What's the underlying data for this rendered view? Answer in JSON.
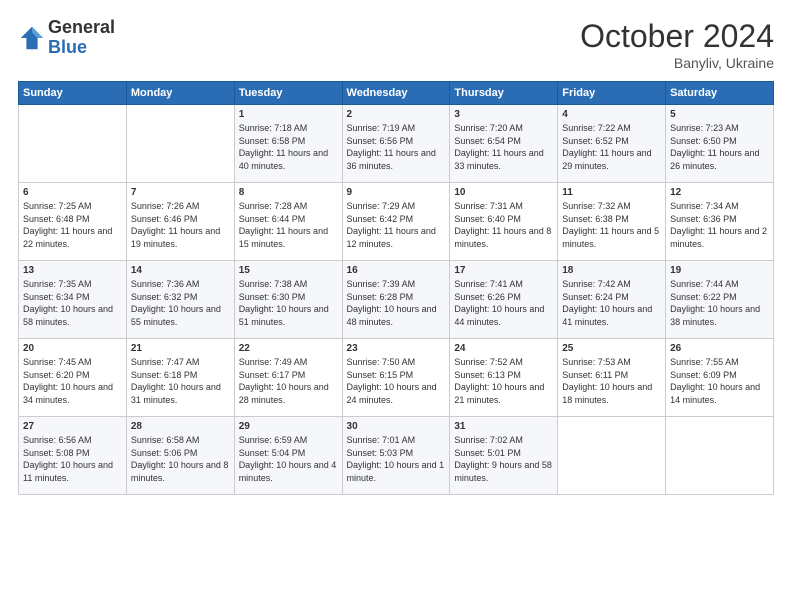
{
  "header": {
    "logo_general": "General",
    "logo_blue": "Blue",
    "month": "October 2024",
    "location": "Banyliv, Ukraine"
  },
  "weekdays": [
    "Sunday",
    "Monday",
    "Tuesday",
    "Wednesday",
    "Thursday",
    "Friday",
    "Saturday"
  ],
  "weeks": [
    [
      {
        "day": "",
        "sunrise": "",
        "sunset": "",
        "daylight": ""
      },
      {
        "day": "",
        "sunrise": "",
        "sunset": "",
        "daylight": ""
      },
      {
        "day": "1",
        "sunrise": "Sunrise: 7:18 AM",
        "sunset": "Sunset: 6:58 PM",
        "daylight": "Daylight: 11 hours and 40 minutes."
      },
      {
        "day": "2",
        "sunrise": "Sunrise: 7:19 AM",
        "sunset": "Sunset: 6:56 PM",
        "daylight": "Daylight: 11 hours and 36 minutes."
      },
      {
        "day": "3",
        "sunrise": "Sunrise: 7:20 AM",
        "sunset": "Sunset: 6:54 PM",
        "daylight": "Daylight: 11 hours and 33 minutes."
      },
      {
        "day": "4",
        "sunrise": "Sunrise: 7:22 AM",
        "sunset": "Sunset: 6:52 PM",
        "daylight": "Daylight: 11 hours and 29 minutes."
      },
      {
        "day": "5",
        "sunrise": "Sunrise: 7:23 AM",
        "sunset": "Sunset: 6:50 PM",
        "daylight": "Daylight: 11 hours and 26 minutes."
      }
    ],
    [
      {
        "day": "6",
        "sunrise": "Sunrise: 7:25 AM",
        "sunset": "Sunset: 6:48 PM",
        "daylight": "Daylight: 11 hours and 22 minutes."
      },
      {
        "day": "7",
        "sunrise": "Sunrise: 7:26 AM",
        "sunset": "Sunset: 6:46 PM",
        "daylight": "Daylight: 11 hours and 19 minutes."
      },
      {
        "day": "8",
        "sunrise": "Sunrise: 7:28 AM",
        "sunset": "Sunset: 6:44 PM",
        "daylight": "Daylight: 11 hours and 15 minutes."
      },
      {
        "day": "9",
        "sunrise": "Sunrise: 7:29 AM",
        "sunset": "Sunset: 6:42 PM",
        "daylight": "Daylight: 11 hours and 12 minutes."
      },
      {
        "day": "10",
        "sunrise": "Sunrise: 7:31 AM",
        "sunset": "Sunset: 6:40 PM",
        "daylight": "Daylight: 11 hours and 8 minutes."
      },
      {
        "day": "11",
        "sunrise": "Sunrise: 7:32 AM",
        "sunset": "Sunset: 6:38 PM",
        "daylight": "Daylight: 11 hours and 5 minutes."
      },
      {
        "day": "12",
        "sunrise": "Sunrise: 7:34 AM",
        "sunset": "Sunset: 6:36 PM",
        "daylight": "Daylight: 11 hours and 2 minutes."
      }
    ],
    [
      {
        "day": "13",
        "sunrise": "Sunrise: 7:35 AM",
        "sunset": "Sunset: 6:34 PM",
        "daylight": "Daylight: 10 hours and 58 minutes."
      },
      {
        "day": "14",
        "sunrise": "Sunrise: 7:36 AM",
        "sunset": "Sunset: 6:32 PM",
        "daylight": "Daylight: 10 hours and 55 minutes."
      },
      {
        "day": "15",
        "sunrise": "Sunrise: 7:38 AM",
        "sunset": "Sunset: 6:30 PM",
        "daylight": "Daylight: 10 hours and 51 minutes."
      },
      {
        "day": "16",
        "sunrise": "Sunrise: 7:39 AM",
        "sunset": "Sunset: 6:28 PM",
        "daylight": "Daylight: 10 hours and 48 minutes."
      },
      {
        "day": "17",
        "sunrise": "Sunrise: 7:41 AM",
        "sunset": "Sunset: 6:26 PM",
        "daylight": "Daylight: 10 hours and 44 minutes."
      },
      {
        "day": "18",
        "sunrise": "Sunrise: 7:42 AM",
        "sunset": "Sunset: 6:24 PM",
        "daylight": "Daylight: 10 hours and 41 minutes."
      },
      {
        "day": "19",
        "sunrise": "Sunrise: 7:44 AM",
        "sunset": "Sunset: 6:22 PM",
        "daylight": "Daylight: 10 hours and 38 minutes."
      }
    ],
    [
      {
        "day": "20",
        "sunrise": "Sunrise: 7:45 AM",
        "sunset": "Sunset: 6:20 PM",
        "daylight": "Daylight: 10 hours and 34 minutes."
      },
      {
        "day": "21",
        "sunrise": "Sunrise: 7:47 AM",
        "sunset": "Sunset: 6:18 PM",
        "daylight": "Daylight: 10 hours and 31 minutes."
      },
      {
        "day": "22",
        "sunrise": "Sunrise: 7:49 AM",
        "sunset": "Sunset: 6:17 PM",
        "daylight": "Daylight: 10 hours and 28 minutes."
      },
      {
        "day": "23",
        "sunrise": "Sunrise: 7:50 AM",
        "sunset": "Sunset: 6:15 PM",
        "daylight": "Daylight: 10 hours and 24 minutes."
      },
      {
        "day": "24",
        "sunrise": "Sunrise: 7:52 AM",
        "sunset": "Sunset: 6:13 PM",
        "daylight": "Daylight: 10 hours and 21 minutes."
      },
      {
        "day": "25",
        "sunrise": "Sunrise: 7:53 AM",
        "sunset": "Sunset: 6:11 PM",
        "daylight": "Daylight: 10 hours and 18 minutes."
      },
      {
        "day": "26",
        "sunrise": "Sunrise: 7:55 AM",
        "sunset": "Sunset: 6:09 PM",
        "daylight": "Daylight: 10 hours and 14 minutes."
      }
    ],
    [
      {
        "day": "27",
        "sunrise": "Sunrise: 6:56 AM",
        "sunset": "Sunset: 5:08 PM",
        "daylight": "Daylight: 10 hours and 11 minutes."
      },
      {
        "day": "28",
        "sunrise": "Sunrise: 6:58 AM",
        "sunset": "Sunset: 5:06 PM",
        "daylight": "Daylight: 10 hours and 8 minutes."
      },
      {
        "day": "29",
        "sunrise": "Sunrise: 6:59 AM",
        "sunset": "Sunset: 5:04 PM",
        "daylight": "Daylight: 10 hours and 4 minutes."
      },
      {
        "day": "30",
        "sunrise": "Sunrise: 7:01 AM",
        "sunset": "Sunset: 5:03 PM",
        "daylight": "Daylight: 10 hours and 1 minute."
      },
      {
        "day": "31",
        "sunrise": "Sunrise: 7:02 AM",
        "sunset": "Sunset: 5:01 PM",
        "daylight": "Daylight: 9 hours and 58 minutes."
      },
      {
        "day": "",
        "sunrise": "",
        "sunset": "",
        "daylight": ""
      },
      {
        "day": "",
        "sunrise": "",
        "sunset": "",
        "daylight": ""
      }
    ]
  ]
}
